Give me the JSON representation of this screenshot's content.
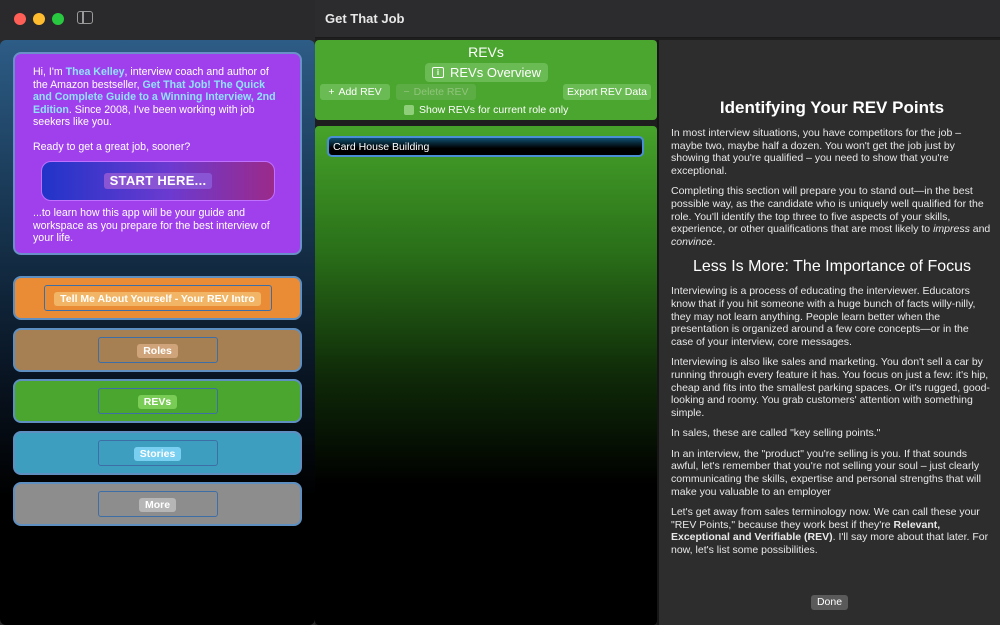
{
  "window": {
    "title": "Get That Job"
  },
  "intro": {
    "p1_a": "Hi, I'm ",
    "p1_name": "Thea Kelley",
    "p1_b": ", interview coach and author of the Amazon bestseller, ",
    "p1_book": "Get That Job! The Quick and Complete Guide to a Winning Interview, 2nd Edition",
    "p1_c": ". Since 2008, I've been working with job seekers like you.",
    "p2": "Ready to get a great job, sooner?",
    "start_label": "START HERE...",
    "p3": "...to learn how this app will be your guide and workspace as you prepare for the best interview of your life."
  },
  "nav": {
    "intro": "Tell Me About Yourself - Your REV Intro",
    "roles": "Roles",
    "revs": "REVs",
    "stories": "Stories",
    "more": "More"
  },
  "revs": {
    "title": "REVs",
    "overview_label": "REVs Overview",
    "add_label": "Add REV",
    "delete_label": "Delete REV",
    "export_label": "Export REV Data",
    "role_only_label": "Show REVs for current role only",
    "items": [
      "Card House Building"
    ]
  },
  "detail": {
    "heading1": "Identifying Your REV Points",
    "para1": "In most interview situations, you have competitors for the job – maybe two, maybe half a dozen. You won't get the job just by showing that you're qualified – you need to show that you're exceptional.",
    "para2_a": "Completing this section will prepare you to stand out—in the best possible way, as the candidate who is uniquely well qualified for the role. You'll identify the top three to five aspects of your skills, experience, or other qualifications that are most likely to ",
    "para2_impress": "impress",
    "para2_b": " and ",
    "para2_convince": "convince",
    "para2_c": ".",
    "heading2": "Less Is More: The Importance of Focus",
    "para3": "Interviewing is a process of educating the interviewer. Educators know that if you hit someone with a huge bunch of facts willy-nilly, they may not learn anything. People learn better when the presentation is organized around a few core concepts—or in the case of your interview, core messages.",
    "para4": "Interviewing is also like sales and marketing. You don't sell a car by running through every feature it has. You focus on just a few: it's hip, cheap and fits into the smallest parking spaces. Or it's rugged, good-looking and roomy. You grab customers' attention with something simple.",
    "para5": "In sales, these are called \"key selling points.\"",
    "para6": "In an interview, the \"product\" you're selling is you. If that sounds awful, let's remember that you're not selling your soul – just clearly communicating the skills, expertise and personal strengths that will make you valuable to an employer",
    "para7_a": "Let's get away from sales terminology now. We can call these your \"REV Points,\" because they work best if they're ",
    "para7_bold": "Relevant, Exceptional and Verifiable (REV)",
    "para7_b": ". I'll say more about that later. For now, let's list some possibilities.",
    "done_label": "Done"
  }
}
